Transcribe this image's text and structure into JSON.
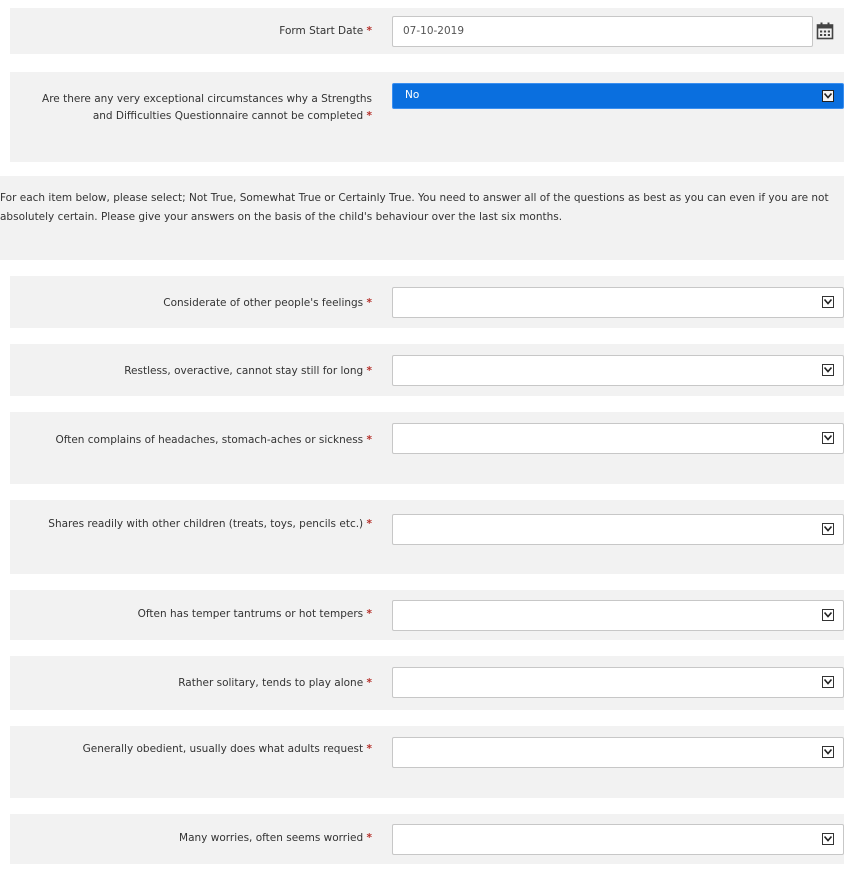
{
  "form_start": {
    "label": "Form Start Date",
    "required_marker": "*",
    "value": "07-10-2019",
    "icon": "calendar-icon"
  },
  "exceptional": {
    "label": "Are there any very exceptional circumstances why a Strengths and Difficulties Questionnaire cannot be completed",
    "required_marker": "*",
    "selected": "No"
  },
  "instructions": "For each item below, please select; Not True, Somewhat True or Certainly True. You need to answer all of the questions as best as you can even if you are not absolutely certain. Please give your answers on the basis of the child's behaviour over the last six months.",
  "questions": [
    {
      "label": "Considerate of other people's feelings",
      "required_marker": "*",
      "selected": ""
    },
    {
      "label": "Restless, overactive, cannot stay still for long",
      "required_marker": "*",
      "selected": ""
    },
    {
      "label": "Often complains of headaches, stomach-aches or sickness",
      "required_marker": "*",
      "selected": ""
    },
    {
      "label": "Shares readily with other children (treats, toys, pencils etc.)",
      "required_marker": "*",
      "selected": ""
    },
    {
      "label": "Often has temper tantrums or hot tempers",
      "required_marker": "*",
      "selected": ""
    },
    {
      "label": "Rather solitary, tends to play alone",
      "required_marker": "*",
      "selected": ""
    },
    {
      "label": "Generally obedient, usually does what adults request",
      "required_marker": "*",
      "selected": ""
    },
    {
      "label": "Many worries, often seems worried",
      "required_marker": "*",
      "selected": ""
    }
  ],
  "colors": {
    "required": "#b5312b",
    "selected_bg": "#0a6fdf",
    "row_bg": "#f2f2f2"
  }
}
